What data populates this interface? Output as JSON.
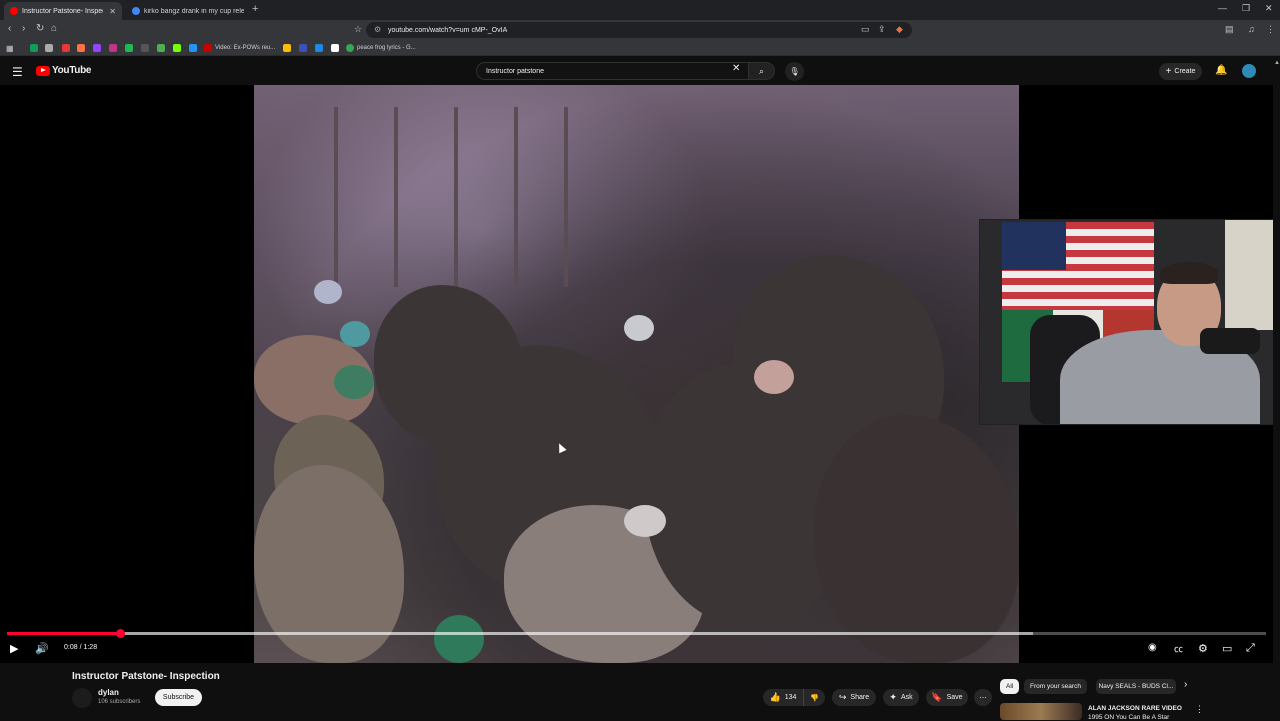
{
  "browser": {
    "tabs": [
      {
        "title": "Instructor Patstone- Inspection",
        "active": true
      },
      {
        "title": "kirko bangz drank in my cup release",
        "active": false
      }
    ],
    "url": "youtube.com/watch?v=um cMP-_OvIA",
    "bookmarks": [
      {
        "label": "Video: Ex-POWs reu..."
      },
      {
        "label": "peace frog lyrics - G..."
      }
    ]
  },
  "youtube": {
    "logo_text": "YouTube",
    "search_value": "Instructor patstone",
    "create_label": "Create"
  },
  "player": {
    "time_current": "0:08",
    "time_total": "1:28",
    "time_display": "0:08 / 1:28",
    "progress_fraction": 0.09,
    "buffer_fraction": 0.815
  },
  "video": {
    "title": "Instructor Patstone- Inspection",
    "channel_name": "dylan",
    "subscribers": "106 subscribers",
    "subscribe_label": "Subscribe",
    "likes": "134",
    "share_label": "Share",
    "ask_label": "Ask",
    "save_label": "Save"
  },
  "recommendations": {
    "chips": [
      "All",
      "From your search",
      "Navy SEALS - BUDS Cl..."
    ],
    "first_title": "ALAN JACKSON RARE VIDEO",
    "first_subtitle": "1995 ON You Can Be A Star"
  },
  "colors": {
    "accent": "#ff0033",
    "brand_red": "#ff0000",
    "background": "#0f0f0f"
  }
}
